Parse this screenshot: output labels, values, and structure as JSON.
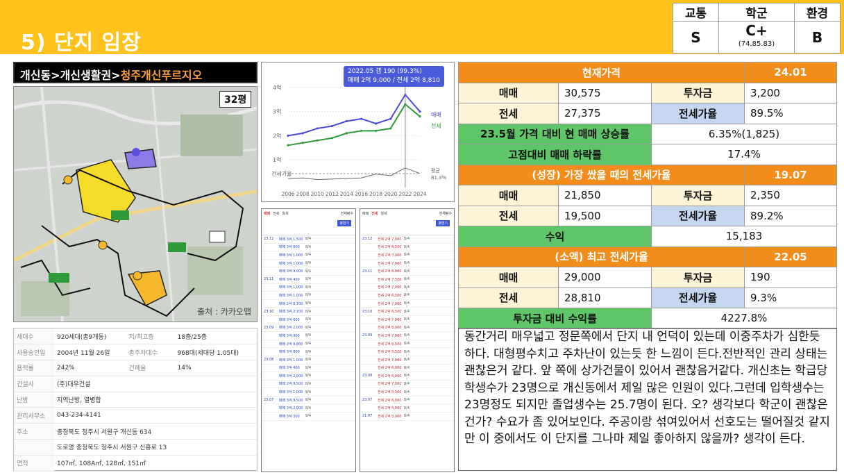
{
  "page_title": "5) 단지 임장",
  "grade": {
    "headers": [
      "교통",
      "학군",
      "환경"
    ],
    "values": [
      "S",
      "C+",
      "B"
    ],
    "school_detail": "(74.85.83)"
  },
  "location": {
    "path": "개신동>개신생활권>",
    "complex": "청주개신푸르지오"
  },
  "map": {
    "size_badge": "32평",
    "source": "출처 : 카카오맵"
  },
  "info": {
    "rows": [
      [
        "세대수",
        "920세대(총9개동)",
        "저/최고층",
        "18층/25층"
      ],
      [
        "사용승인일",
        "2004년 11월 26일",
        "총주차대수",
        "968대(세대당 1.05대)"
      ],
      [
        "용적률",
        "242%",
        "건폐율",
        "14%"
      ],
      [
        "건설사",
        "(주)대우건설",
        "",
        ""
      ],
      [
        "난방",
        "지역난방, 열병합",
        "",
        ""
      ],
      [
        "관리사무소",
        "043-234-4141",
        "",
        ""
      ],
      [
        "주소",
        "충청북도 청주시 서원구 개신동 634",
        "",
        ""
      ],
      [
        "",
        "도로명 충청북도 청주시 서원구 신흥로 13",
        "",
        ""
      ],
      [
        "면적",
        "107㎡, 108A㎡, 128㎡, 151㎡",
        "",
        ""
      ]
    ]
  },
  "chart": {
    "tooltip_line1": "2022.05  갭 190 (99.3%)",
    "tooltip_line2": "매매 2억 9,000 / 전세 2억 8,810",
    "legend_sale": "매매",
    "legend_jeonse": "전세",
    "ratio_label": "전세가율",
    "ratio_tag": "평균",
    "ratio_value": "81.3%",
    "chart_data": {
      "type": "line",
      "x": [
        2006,
        2008,
        2010,
        2012,
        2014,
        2016,
        2018,
        2020,
        2022,
        2024
      ],
      "ytick_labels": [
        "4억",
        "3억",
        "2억",
        "1억"
      ],
      "ylim": [
        1,
        4
      ],
      "series": [
        {
          "name": "매매",
          "color": "#4a4ae0",
          "values": [
            2.0,
            2.1,
            2.3,
            2.4,
            2.6,
            2.7,
            2.5,
            2.7,
            3.7,
            3.0
          ]
        },
        {
          "name": "전세",
          "color": "#2e9a3a",
          "values": [
            1.6,
            1.7,
            1.8,
            1.9,
            2.1,
            2.2,
            2.2,
            2.3,
            3.3,
            2.8
          ]
        }
      ]
    }
  },
  "tx_panels": [
    {
      "tabs": [
        "매매",
        "전세",
        "월세"
      ],
      "filter": "전체평수",
      "button": "평형기",
      "rows": [
        [
          "23.12",
          "매매 3억 1,500",
          "8/4"
        ],
        [
          "",
          "매매 3억 800",
          "8/4"
        ],
        [
          "",
          "매매 3억 1,000",
          "8/4"
        ],
        [
          "",
          "매매 3억 1,000",
          "8/4"
        ],
        [
          "",
          "매매 3억 9,000",
          "8/4"
        ],
        [
          "23.11",
          "매매 3억 400",
          "8/4"
        ],
        [
          "",
          "매매 3억 1,000",
          "8/4"
        ],
        [
          "",
          "매매 3억 1,000",
          "8/4"
        ],
        [
          "",
          "매매 2억 8,700",
          "8/4"
        ],
        [
          "23.10",
          "매매 3억 2,700",
          "8/4"
        ],
        [
          "",
          "매매 3억 600",
          "8/4"
        ],
        [
          "23.09",
          "매매 3억 2,000",
          "8/4"
        ],
        [
          "",
          "매매 3억 900",
          "8/4"
        ],
        [
          "",
          "매매 2억 9,800",
          "8/4"
        ],
        [
          "",
          "매매 3억 800",
          "8/4"
        ],
        [
          "23.08",
          "매매 3억 1,000",
          "8/4"
        ],
        [
          "",
          "매매 3억 400",
          "8/4"
        ],
        [
          "",
          "매매 3억 2,000",
          "8/4"
        ],
        [
          "",
          "매매 2억 9,500",
          "8/4"
        ],
        [
          "",
          "매매 3억 1,000",
          "8/4"
        ],
        [
          "23.07",
          "매매 3억 9,500",
          "8/4"
        ],
        [
          "",
          "매매 3억 2,000",
          "8/4"
        ],
        [
          "",
          "매매 3억 300",
          "8/4"
        ]
      ]
    },
    {
      "tabs": [
        "매매",
        "전세",
        "월세"
      ],
      "filter": "전체평수",
      "button": "평형기",
      "rows": [
        [
          "23.12",
          "전세 2억 7,000",
          "8/4"
        ],
        [
          "",
          "전세 2억 6,500",
          "8/4"
        ],
        [
          "",
          "전세 2억 7,000",
          "8/4"
        ],
        [
          "",
          "전세 2억 7,000",
          "8/4"
        ],
        [
          "23.11",
          "전세 2억 6,000",
          "8/4"
        ],
        [
          "",
          "전세 2억 7,500",
          "8/4"
        ],
        [
          "",
          "전세 2억 7,000",
          "8/4"
        ],
        [
          "",
          "전세 2억 6,500",
          "8/4"
        ],
        [
          "",
          "전세 2억 7,000",
          "8/4"
        ],
        [
          "23.10",
          "전세 2억 6,500",
          "8/4"
        ],
        [
          "",
          "전세 2억 7,000",
          "8/4"
        ],
        [
          "",
          "전세 2억 6,000",
          "8/4"
        ],
        [
          "23.09",
          "전세 2억 7,000",
          "8/4"
        ],
        [
          "",
          "전세 2억 6,500",
          "8/4"
        ],
        [
          "",
          "전세 2억 5,500",
          "8/4"
        ],
        [
          "",
          "전세 2억 7,000",
          "8/4"
        ],
        [
          "",
          "전세 2억 6,000",
          "8/4"
        ],
        [
          "23.08",
          "전세 2억 6,000",
          "8/4"
        ],
        [
          "",
          "전세 2억 7,000",
          "8/4"
        ],
        [
          "",
          "전세 2억 5,500",
          "8/4"
        ],
        [
          "23.07",
          "전세 2억 6,000",
          "8/4"
        ],
        [
          "",
          "전세 2억 5,000",
          "8/4"
        ],
        [
          "21.07",
          "전세 2억 5,000",
          "8/4"
        ]
      ]
    }
  ],
  "price_table": {
    "now_label": "현재가격",
    "now_date": "24.01",
    "sale": "매매",
    "jeonse": "전세",
    "invest": "투자금",
    "ratio": "전세가율",
    "now_sale": "30,575",
    "now_invest": "3,200",
    "now_jeonse": "27,375",
    "now_ratio": "89.5%",
    "rise_label": "23.5월 가격 대비 현 매매 상승률",
    "rise_value": "6.35%(1,825)",
    "drop_label": "고점대비 매매 하락률",
    "drop_value": "17.4%",
    "grow_label": "(성장) 가장 쌌을 때의 전세가율",
    "grow_date": "19.07",
    "grow_sale": "21,850",
    "grow_invest": "2,350",
    "grow_jeonse": "19,500",
    "grow_ratio": "89.2%",
    "profit_label": "수익",
    "profit_value": "15,183",
    "peak_label": "(소액) 최고 전세가율",
    "peak_date": "22.05",
    "peak_sale": "29,000",
    "peak_invest": "190",
    "peak_jeonse": "28,810",
    "peak_ratio": "9.3%",
    "yield_label": "투자금 대비 수익률",
    "yield_value": "4227.8%"
  },
  "note": "동간거리 매우넓고 정문쪽에서 단지 내 언덕이 있는데 이중주차가 심한듯하다. 대형평수치고 주차난이 있는듯 한 느낌이 든다.전반적인 관리 상태는 괜찮은거 같다. 앞 쪽에 상가건물이 있어서 괜찮음거같다. 개신초는 학급당 학생수가 23명으로 개신동에서 제일 많은 인원이 있다.그런데 입학생수는 23명정도 되지만 졸업생수는 25.7명이 된다. 오? 생각보다 학군이 괜찮은건가? 수요가 좀 있어보인다. 주공이랑 섞여있어서 선호도는 떨어질것 같지만 이 중에서도 이 단지를 그나마 제일 좋아하지 않을까? 생각이 든다."
}
